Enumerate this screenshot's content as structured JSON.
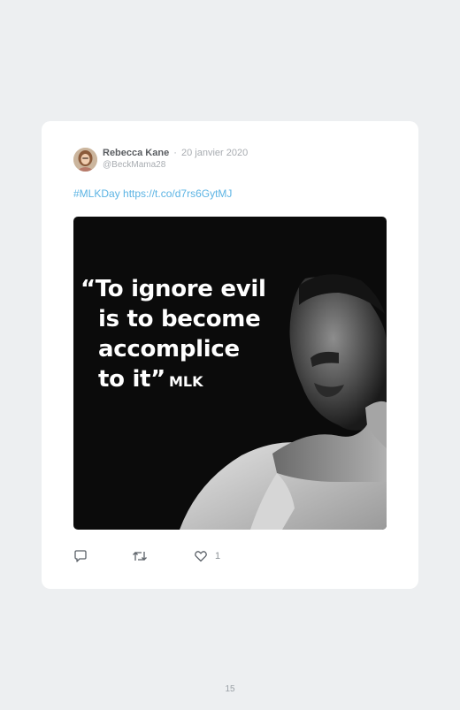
{
  "tweet": {
    "author_name": "Rebecca Kane",
    "separator": "·",
    "date": "20 janvier 2020",
    "handle": "@BeckMama28",
    "hashtag": "#MLKDay",
    "link": "https://t.co/d7rs6GytMJ",
    "image": {
      "quote_lines": [
        "“To ignore evil",
        "is to become",
        "accomplice",
        "to it”"
      ],
      "attribution": "MLK"
    },
    "actions": {
      "reply_icon": "speech-bubble-icon",
      "retweet_icon": "retweet-arrows-icon",
      "like_icon": "heart-icon",
      "like_count": "1"
    }
  },
  "page": {
    "number": "15"
  },
  "colors": {
    "background": "#edeff1",
    "card": "#ffffff",
    "link": "#5cb4e4",
    "name": "#5a5d61",
    "muted": "#a8acb1",
    "photo_bg": "#0b0b0b"
  }
}
